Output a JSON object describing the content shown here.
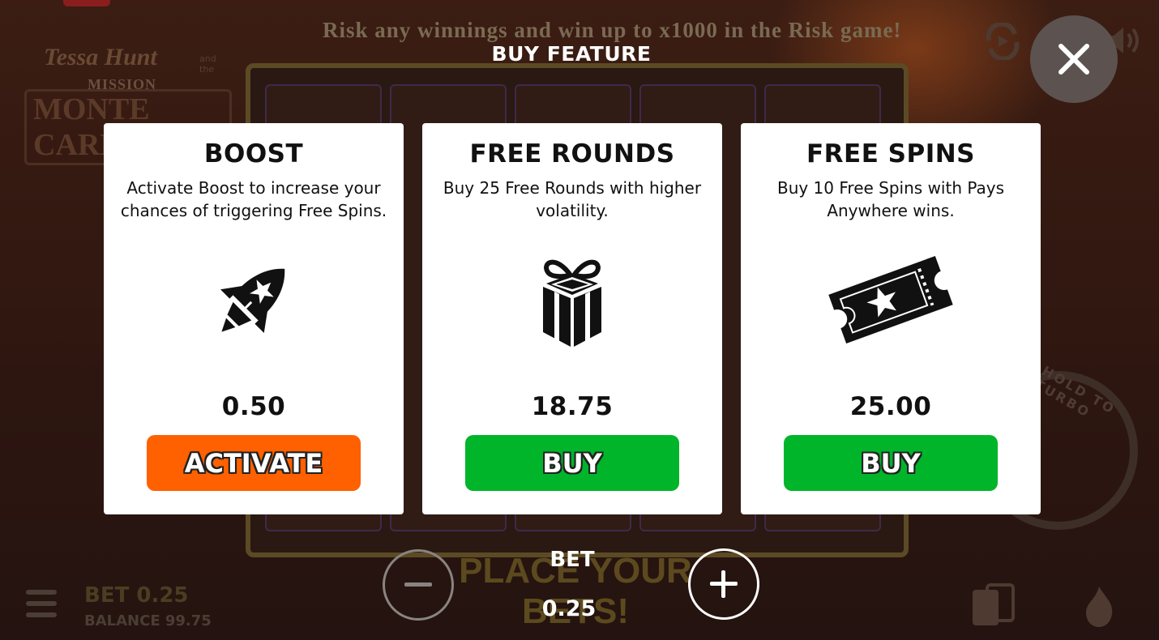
{
  "background": {
    "promo_text": "Risk any winnings and win up to x1000 in the Risk game!",
    "logo": {
      "line1": "Tessa Hunt",
      "line1_small": "and the",
      "line2": "MISSION",
      "line3": "MONTE CARLO"
    },
    "place_bets": "PLACE YOUR BETS!",
    "bet_line": "BET 0.25",
    "balance_line": "BALANCE 99.75",
    "turbo_hint": "HOLD TO TURBO"
  },
  "dialog": {
    "title": "BUY FEATURE",
    "close_icon": "close-icon",
    "cards": [
      {
        "title": "BOOST",
        "description": "Activate Boost to increase your chances of triggering Free Spins.",
        "icon": "rocket-icon",
        "price": "0.50",
        "button_label": "ACTIVATE",
        "button_color": "#ff6000"
      },
      {
        "title": "FREE ROUNDS",
        "description": "Buy 25 Free Rounds with higher volatility.",
        "icon": "gift-icon",
        "price": "18.75",
        "button_label": "BUY",
        "button_color": "#00b52a"
      },
      {
        "title": "FREE SPINS",
        "description": "Buy 10 Free Spins with Pays Anywhere wins.",
        "icon": "ticket-icon",
        "price": "25.00",
        "button_label": "BUY",
        "button_color": "#00b52a"
      }
    ]
  },
  "bet": {
    "label": "BET",
    "value": "0.25"
  }
}
